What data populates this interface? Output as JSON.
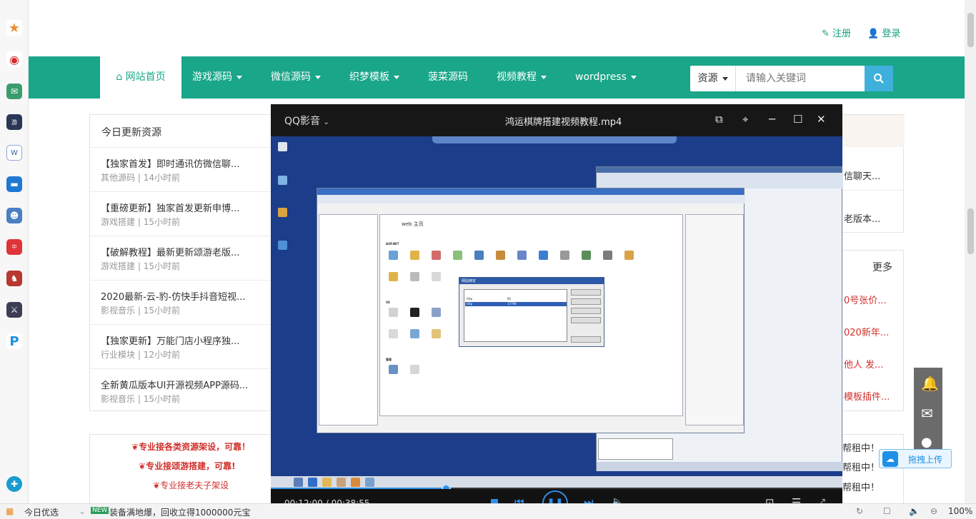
{
  "header": {
    "register_label": "注册",
    "login_label": "登录"
  },
  "nav": {
    "items": [
      {
        "label": "网站首页"
      },
      {
        "label": "游戏源码"
      },
      {
        "label": "微信源码"
      },
      {
        "label": "织梦模板"
      },
      {
        "label": "菠菜源码"
      },
      {
        "label": "视频教程"
      },
      {
        "label": "wordpress"
      }
    ],
    "search_type": "资源",
    "search_placeholder": "请输入关键词"
  },
  "today_panel": {
    "title": "今日更新资源",
    "items": [
      {
        "title": "【独家首发】即时通讯仿微信聊...",
        "category": "其他源码",
        "time": "14小时前"
      },
      {
        "title": "【重磅更新】独家首发更新申博...",
        "category": "游戏搭建",
        "time": "15小时前"
      },
      {
        "title": "【破解教程】最新更新颂游老版...",
        "category": "游戏搭建",
        "time": "15小时前"
      },
      {
        "title": "2020最新-云-豹-仿快手抖音短视...",
        "category": "影视音乐",
        "time": "15小时前"
      },
      {
        "title": "【独家更新】万能门店小程序独...",
        "category": "行业模块",
        "time": "12小时前"
      },
      {
        "title": "全新黄瓜版本UI开源视频APP源码...",
        "category": "影视音乐",
        "time": "15小时前"
      }
    ]
  },
  "right_panel": {
    "items": [
      "信聊天...",
      "老版本..."
    ],
    "more_label": "更多",
    "red_items": [
      "0号张价...",
      "020新年...",
      "他人 发...",
      "模板插件..."
    ],
    "rent_items": [
      "帮租中！",
      "帮租中！",
      "帮租中！"
    ]
  },
  "ads": [
    "专业接各类资源架设，可靠！",
    "专业接颂游搭建，可靠!",
    "专业接老夫子架设"
  ],
  "player": {
    "app_name": "QQ影音",
    "file_title": "鸿运棋牌搭建视频教程.mp4",
    "time_current": "00:12:00",
    "time_total": "00:38:55",
    "progress": 0.308
  },
  "video_screen": {
    "iis_title": "web 主页",
    "dialog_title": "网站绑定",
    "dialog_rows": [
      [
        "http",
        "80"
      ],
      [
        "http",
        "17799"
      ]
    ],
    "section_labels": [
      "ASP.NET",
      "IIS",
      "管理"
    ]
  },
  "float_widget": {
    "upload_label": "拖拽上传"
  },
  "status_bar": {
    "left_label": "今日优选",
    "news_badge": "NEW",
    "news_text": "装备满地爆，回收立得1000000元宝",
    "zoom": "100%"
  },
  "colors": {
    "brand": "#1aa688",
    "accent_red": "#d0302b",
    "search_btn": "#3fb0dc",
    "player_bg": "#121212"
  }
}
